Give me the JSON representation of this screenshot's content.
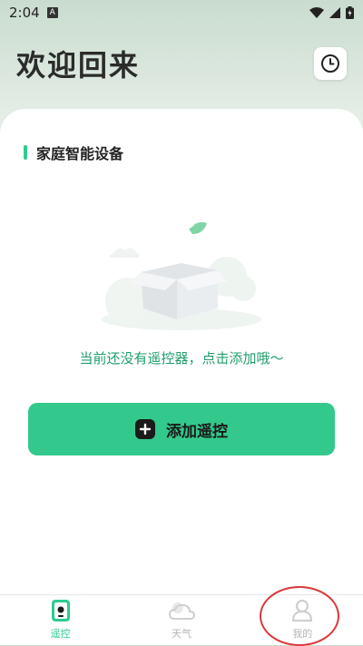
{
  "status_bar": {
    "time": "2:04",
    "notification_badge": "A"
  },
  "header": {
    "title": "欢迎回来",
    "history_icon": "clock-icon"
  },
  "section": {
    "title": "家庭智能设备"
  },
  "empty_state": {
    "message": "当前还没有遥控器，点击添加哦～"
  },
  "add_button": {
    "label": "添加遥控",
    "icon": "plus-icon"
  },
  "bottom_nav": {
    "items": [
      {
        "label": "遥控",
        "icon": "remote-icon",
        "active": true
      },
      {
        "label": "天气",
        "icon": "weather-icon",
        "active": false
      },
      {
        "label": "我的",
        "icon": "user-icon",
        "active": false
      }
    ]
  },
  "colors": {
    "accent": "#2ecc8f",
    "button": "#33c98c",
    "annotation": "#d93a3a"
  }
}
